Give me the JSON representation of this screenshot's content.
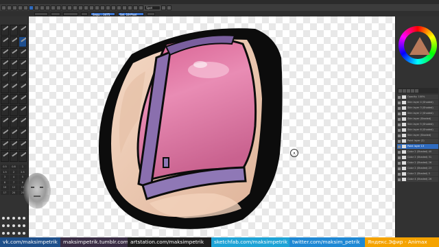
{
  "toolbar": {
    "field1": "Sequ... 3475",
    "field2": "Sel. 18-Pixel",
    "field3": "Spot"
  },
  "tool_sizes": [
    "0.5",
    "0.8",
    "1",
    "1.5",
    "2",
    "2.5",
    "3",
    "4",
    "5",
    "6",
    "7",
    "8",
    "10",
    "12",
    "15",
    "17",
    "20",
    "25"
  ],
  "layers": [
    {
      "name": "Opacity: 100%",
      "selected": false
    },
    {
      "name": "Skin layer 4 (Shaded)",
      "selected": false
    },
    {
      "name": "Skin layer 3 (Shaded)",
      "selected": false
    },
    {
      "name": "Skin layer 2 (Shaded)",
      "selected": false
    },
    {
      "name": "Skin layer (Shaded)",
      "selected": false
    },
    {
      "name": "Skin layer 5 (Shaded)",
      "selected": false
    },
    {
      "name": "Skin layer 6 (Shaded)",
      "selected": false
    },
    {
      "name": "Skin layer (Shaded)",
      "selected": false
    },
    {
      "name": "Paint layer (2)",
      "selected": false
    },
    {
      "name": "Paint layer 13",
      "selected": true
    },
    {
      "name": "Color 2 (Shaded) 40",
      "selected": false
    },
    {
      "name": "Color 2 (Shaded) 31",
      "selected": false
    },
    {
      "name": "Color 2 (Shaded) 26",
      "selected": false
    },
    {
      "name": "Color 2 (Shaded) 23",
      "selected": false
    },
    {
      "name": "Color 2 (Shaded) 5",
      "selected": false
    },
    {
      "name": "Color 4 (Shaded) 26",
      "selected": false
    }
  ],
  "footer": [
    {
      "text": "vk.com/maksimpetrik",
      "color": "#1e4f8a",
      "width": 88
    },
    {
      "text": "maksimpetrik.tumblr.com",
      "color": "#3a2d45",
      "width": 98
    },
    {
      "text": "artstation.com/maksimpetrik",
      "color": "#1d1d1d",
      "width": 122
    },
    {
      "text": "sketchfab.com/maksimpetrik",
      "color": "#1da3d6",
      "width": 114
    },
    {
      "text": "twitter.com/maksim_petrik",
      "color": "#1e88d4",
      "width": 110
    },
    {
      "text": "Яндекс.Эфир - Animax",
      "color": "#f5a300",
      "width": 108
    }
  ],
  "colors": {
    "skin": "#e8c2a8",
    "pink": "#e07ba6",
    "strap": "#8a6fae",
    "outline": "#0c0c0c"
  }
}
